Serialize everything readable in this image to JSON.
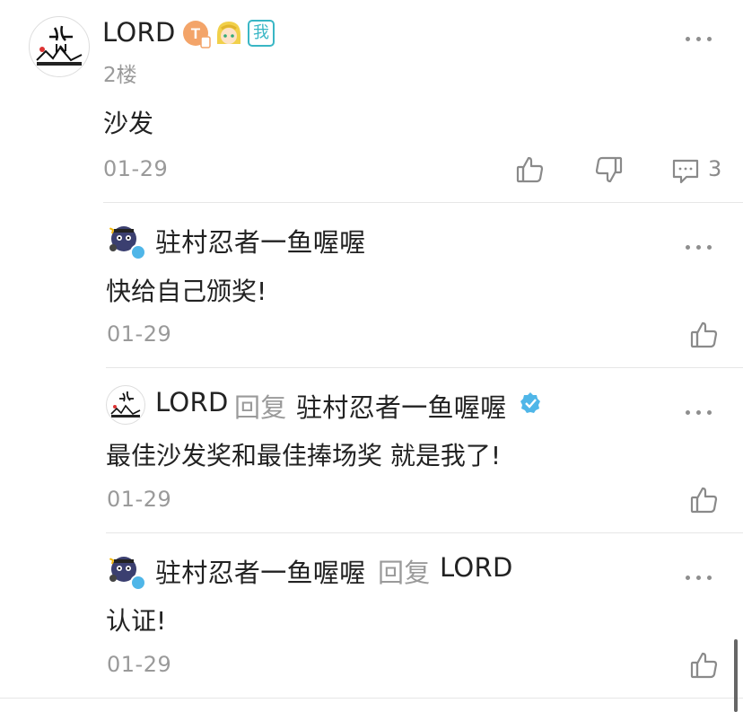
{
  "main_comment": {
    "author": "LORD",
    "badge_me": "我",
    "floor": "2楼",
    "content": "沙发",
    "date": "01-29",
    "reply_count": "3"
  },
  "replies": [
    {
      "author": "驻村忍者一鱼喔喔",
      "content": "快给自己颁奖!",
      "date": "01-29"
    },
    {
      "author": "LORD",
      "reply_word": "回复",
      "reply_to": "驻村忍者一鱼喔喔",
      "content": "最佳沙发奖和最佳捧场奖 就是我了!",
      "date": "01-29"
    },
    {
      "author": "驻村忍者一鱼喔喔",
      "reply_word": "回复",
      "reply_to": "LORD",
      "content": "认证!",
      "date": "01-29"
    }
  ],
  "icons": [
    "more-icon",
    "like-icon",
    "dislike-icon",
    "comment-icon",
    "verified-icon",
    "t-level-icon",
    "anime-avatar-icon"
  ],
  "colors": {
    "text": "#222222",
    "secondary": "#9a9a9a",
    "accent": "#39b6c5",
    "verified": "#4fb6e8",
    "divider": "#e6e6e6"
  }
}
